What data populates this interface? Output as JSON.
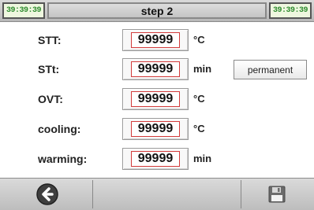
{
  "header": {
    "clock_left": "39:39:39",
    "title": "step 2",
    "clock_right": "39:39:39"
  },
  "rows": [
    {
      "label": "STT:",
      "value": "99999",
      "unit": "°C"
    },
    {
      "label": "STt:",
      "value": "99999",
      "unit": "min",
      "button": "permanent"
    },
    {
      "label": "OVT:",
      "value": "99999",
      "unit": "°C"
    },
    {
      "label": "cooling:",
      "value": "99999",
      "unit": "°C"
    },
    {
      "label": "warming:",
      "value": "99999",
      "unit": "min"
    }
  ],
  "footer": {
    "back_icon": "back-arrow-circle-icon",
    "save_icon": "floppy-disk-icon"
  },
  "colors": {
    "clock_text": "#2c8a2c",
    "value_border": "#d23b3b"
  }
}
